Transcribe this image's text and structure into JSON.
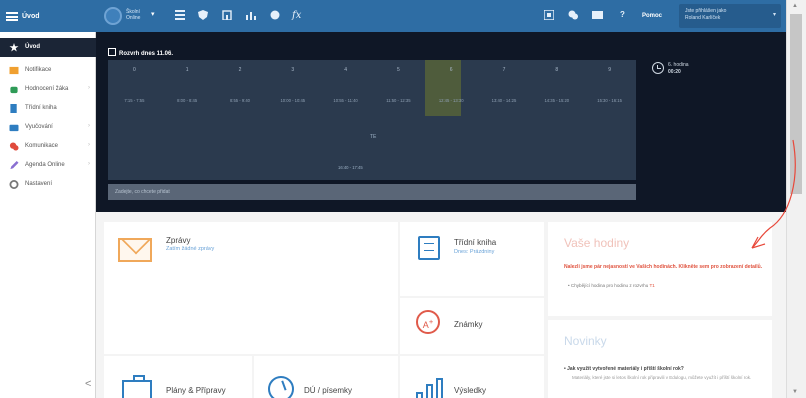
{
  "brand": "Úvod",
  "sidebar": {
    "items": [
      {
        "label": "Úvod",
        "icon": "star-icon",
        "color": "#ffffff"
      },
      {
        "label": "Notifikace",
        "icon": "bell-icon",
        "color": "#f0a030"
      },
      {
        "label": "Hodnocení žáka",
        "icon": "graduation-cap-icon",
        "color": "#2f9b57"
      },
      {
        "label": "Třídní kniha",
        "icon": "book-icon",
        "color": "#2e7dc0"
      },
      {
        "label": "Vyučování",
        "icon": "briefcase-icon",
        "color": "#2e7dc0"
      },
      {
        "label": "Komunikace",
        "icon": "chat-icon",
        "color": "#e04a3c"
      },
      {
        "label": "Agenda Online",
        "icon": "pencil-icon",
        "color": "#8a6fd1"
      },
      {
        "label": "Nastavení",
        "icon": "gear-icon",
        "color": "#777777"
      }
    ],
    "collapse_label": "<"
  },
  "topbar": {
    "school_line1": "Školní",
    "school_line2": "Online",
    "help_label": "Pomoc",
    "user_line1": "Jste přihlášen jako",
    "user_line2": "Roland Karlíček",
    "icons": [
      "grid-icon",
      "shield-icon",
      "building-icon",
      "chart-icon",
      "web-icon",
      "fx-icon"
    ],
    "right_icons": [
      "app-icon",
      "chat-icon",
      "mail-icon",
      "help-icon"
    ]
  },
  "schedule": {
    "title": "Rozvrh dnes 11.06.",
    "hours": [
      "0",
      "1",
      "2",
      "3",
      "4",
      "5",
      "6",
      "7",
      "8",
      "9"
    ],
    "times": [
      "7:15 - 7:55",
      "8:00 - 8:45",
      "8:55 - 9:40",
      "10:00 - 10:45",
      "10:55 - 11:40",
      "11:50 - 12:35",
      "12:45 - 13:30",
      "13:40 - 14:25",
      "14:35 - 15:20",
      "15:30 - 16:15"
    ],
    "highlighted_hour": 6,
    "lesson_a": "TE",
    "lesson_b": "16:40 - 17:45",
    "next_label": "6. hodina",
    "next_time": "00:20",
    "search_placeholder": "Zadejte, co chcete přidat"
  },
  "tiles": {
    "messages_title": "Zprávy",
    "messages_sub": "Zatím žádné zprávy",
    "classbook_title": "Třídní kniha",
    "classbook_sub": "Dnes: Prázdniny",
    "grades_title": "Známky",
    "plans_title": "Plány & Přípravy",
    "homework_title": "DÚ / písemky",
    "results_title": "Výsledky"
  },
  "hours_panel": {
    "title": "Vaše hodiny",
    "warning": "Nalezli jsme pár nejasností ve Vašich hodinách. Klikněte sem pro zobrazení detailů.",
    "item": "Chybějící hodina pro hodinu z rozvrhu",
    "item_tag": "T1"
  },
  "news_panel": {
    "title": "Novinky",
    "headline": "Jak využít vytvořené materiály i příští školní rok?",
    "body": "Materiály, které jste si letos školní rok připravili v Edulogu, můžete využít i příští školní rok."
  },
  "annotation_color": "#e8483a"
}
